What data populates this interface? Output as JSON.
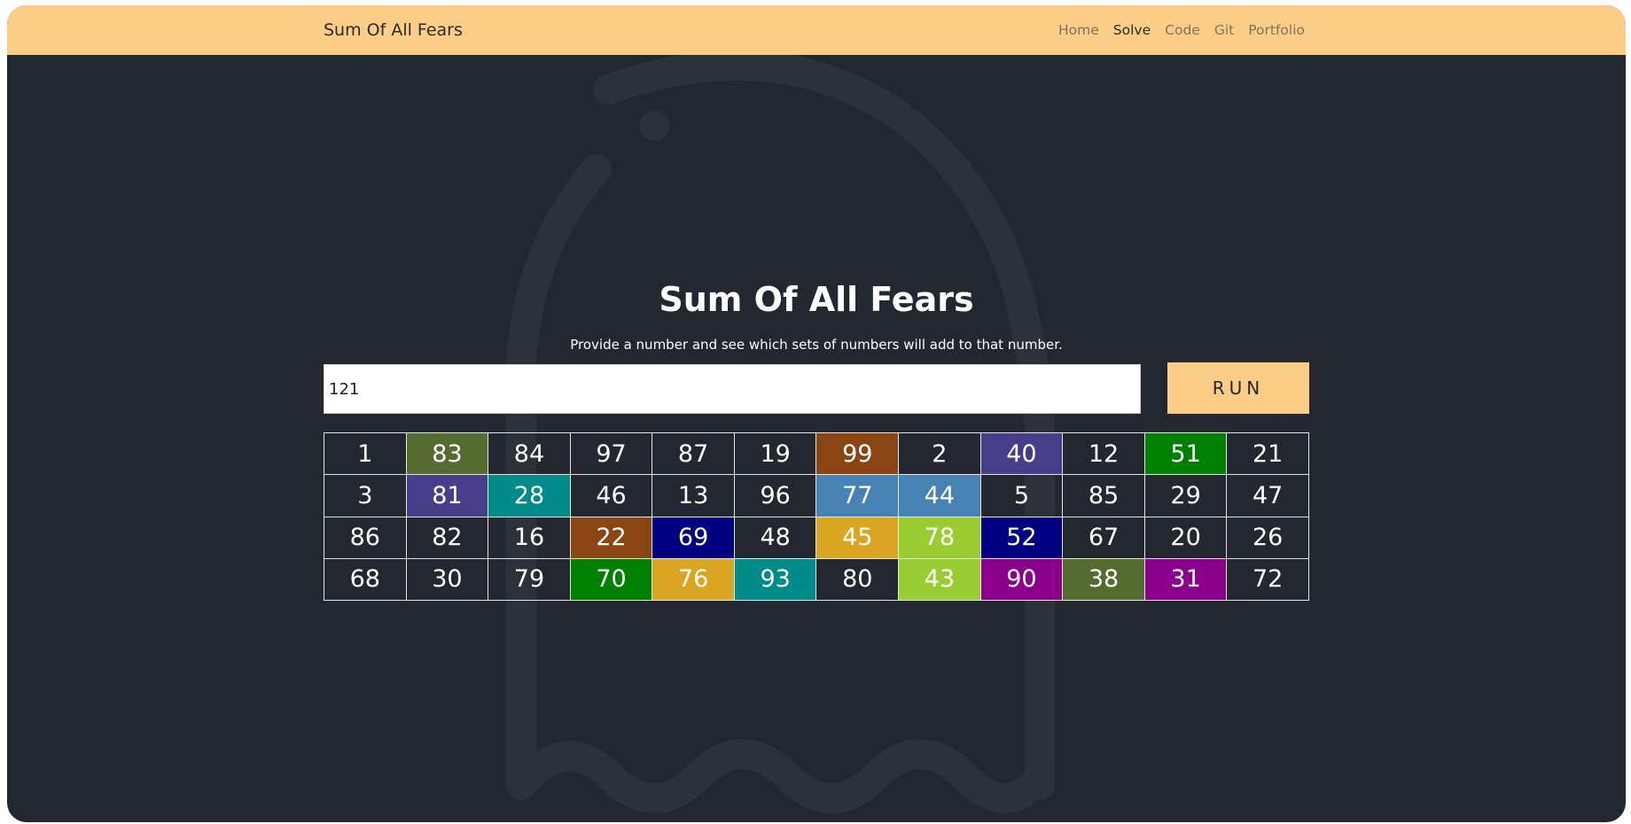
{
  "navbar": {
    "brand": "Sum Of All Fears",
    "links": [
      {
        "label": "Home",
        "active": false
      },
      {
        "label": "Solve",
        "active": true
      },
      {
        "label": "Code",
        "active": false
      },
      {
        "label": "Git",
        "active": false
      },
      {
        "label": "Portfolio",
        "active": false
      }
    ]
  },
  "main": {
    "title": "Sum Of All Fears",
    "subtitle": "Provide a number and see which sets of numbers will add to that number.",
    "input_value": "121",
    "run_label": "RUN"
  },
  "grid": {
    "rows": [
      [
        {
          "n": "1",
          "c": ""
        },
        {
          "n": "83",
          "c": "#556b2f"
        },
        {
          "n": "84",
          "c": ""
        },
        {
          "n": "97",
          "c": ""
        },
        {
          "n": "87",
          "c": ""
        },
        {
          "n": "19",
          "c": ""
        },
        {
          "n": "99",
          "c": "#8b4513"
        },
        {
          "n": "2",
          "c": ""
        },
        {
          "n": "40",
          "c": "#483d8b"
        },
        {
          "n": "12",
          "c": ""
        },
        {
          "n": "51",
          "c": "#008000"
        },
        {
          "n": "21",
          "c": ""
        }
      ],
      [
        {
          "n": "3",
          "c": ""
        },
        {
          "n": "81",
          "c": "#483d8b"
        },
        {
          "n": "28",
          "c": "#008b8b"
        },
        {
          "n": "46",
          "c": ""
        },
        {
          "n": "13",
          "c": ""
        },
        {
          "n": "96",
          "c": ""
        },
        {
          "n": "77",
          "c": "#4682b4"
        },
        {
          "n": "44",
          "c": "#4682b4"
        },
        {
          "n": "5",
          "c": ""
        },
        {
          "n": "85",
          "c": ""
        },
        {
          "n": "29",
          "c": ""
        },
        {
          "n": "47",
          "c": ""
        }
      ],
      [
        {
          "n": "86",
          "c": ""
        },
        {
          "n": "82",
          "c": ""
        },
        {
          "n": "16",
          "c": ""
        },
        {
          "n": "22",
          "c": "#8b4513"
        },
        {
          "n": "69",
          "c": "#000080"
        },
        {
          "n": "48",
          "c": ""
        },
        {
          "n": "45",
          "c": "#daa520"
        },
        {
          "n": "78",
          "c": "#9acd32"
        },
        {
          "n": "52",
          "c": "#000080"
        },
        {
          "n": "67",
          "c": ""
        },
        {
          "n": "20",
          "c": ""
        },
        {
          "n": "26",
          "c": ""
        }
      ],
      [
        {
          "n": "68",
          "c": ""
        },
        {
          "n": "30",
          "c": ""
        },
        {
          "n": "79",
          "c": ""
        },
        {
          "n": "70",
          "c": "#008000"
        },
        {
          "n": "76",
          "c": "#daa520"
        },
        {
          "n": "93",
          "c": "#008b8b"
        },
        {
          "n": "80",
          "c": ""
        },
        {
          "n": "43",
          "c": "#9acd32"
        },
        {
          "n": "90",
          "c": "#8b008b"
        },
        {
          "n": "38",
          "c": "#556b2f"
        },
        {
          "n": "31",
          "c": "#8b008b"
        },
        {
          "n": "72",
          "c": ""
        }
      ]
    ]
  },
  "colors": {
    "accent": "#fbcd87",
    "background": "#23272f",
    "cell_border": "#e6e6e6"
  }
}
